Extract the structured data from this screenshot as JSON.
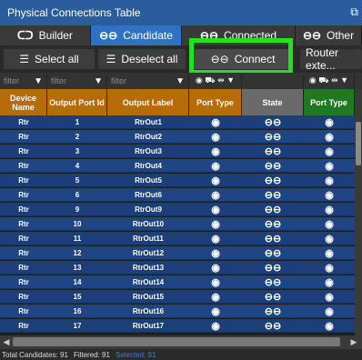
{
  "window": {
    "title": "Physical Connections Table",
    "ext_icon": "external-window-icon"
  },
  "tabs": [
    {
      "glyph": "ᑕᑐ",
      "label": "Builder"
    },
    {
      "glyph": "⊖⊖",
      "label": "Candidate"
    },
    {
      "glyph": "⊖⊖",
      "label": "Connected"
    },
    {
      "glyph": "⊖⊖",
      "label": "Other"
    }
  ],
  "toolbar": {
    "select_all": "Select all",
    "deselect_all": "Deselect all",
    "connect": "Connect",
    "router": "Router exte..."
  },
  "filters": {
    "placeholder": "filter",
    "icons": "◉ ⛟ ⇹ ▼"
  },
  "columns": [
    {
      "label": "Device Name",
      "color": "#b86b09"
    },
    {
      "label": "Output Port Id",
      "color": "#b86b09"
    },
    {
      "label": "Output Label",
      "color": "#b86b09"
    },
    {
      "label": "Port Type",
      "color": "#b86b09"
    },
    {
      "label": "State",
      "color": "#6a6a6a"
    },
    {
      "label": "Port Type",
      "color": "#1f7a1f"
    }
  ],
  "rows": [
    {
      "device": "Rtr",
      "port_id": "1",
      "label": "RtrOut1"
    },
    {
      "device": "Rtr",
      "port_id": "2",
      "label": "RtrOut2"
    },
    {
      "device": "Rtr",
      "port_id": "3",
      "label": "RtrOut3"
    },
    {
      "device": "Rtr",
      "port_id": "4",
      "label": "RtrOut4"
    },
    {
      "device": "Rtr",
      "port_id": "5",
      "label": "RtrOut5"
    },
    {
      "device": "Rtr",
      "port_id": "6",
      "label": "RtrOut6"
    },
    {
      "device": "Rtr",
      "port_id": "9",
      "label": "RtrOut9"
    },
    {
      "device": "Rtr",
      "port_id": "10",
      "label": "RtrOut10"
    },
    {
      "device": "Rtr",
      "port_id": "11",
      "label": "RtrOut11"
    },
    {
      "device": "Rtr",
      "port_id": "12",
      "label": "RtrOut12"
    },
    {
      "device": "Rtr",
      "port_id": "13",
      "label": "RtrOut13"
    },
    {
      "device": "Rtr",
      "port_id": "14",
      "label": "RtrOut14"
    },
    {
      "device": "Rtr",
      "port_id": "15",
      "label": "RtrOut15"
    },
    {
      "device": "Rtr",
      "port_id": "16",
      "label": "RtrOut16"
    },
    {
      "device": "Rtr",
      "port_id": "17",
      "label": "RtrOut17"
    }
  ],
  "glyphs": {
    "port_type": "◉",
    "state": "⊖⊖"
  },
  "status": {
    "total": "Total Candidates: 91",
    "filtered": "Filtered: 91",
    "selected": "Selected: 91"
  }
}
